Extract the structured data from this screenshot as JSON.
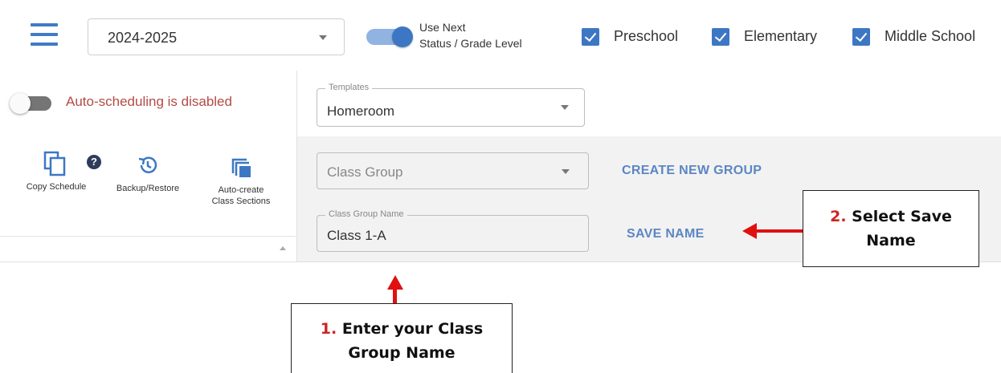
{
  "topbar": {
    "school_year": "2024-2025",
    "use_next_line1": "Use Next",
    "use_next_line2": "Status / Grade Level",
    "use_next_enabled": true,
    "levels": [
      {
        "label": "Preschool",
        "checked": true
      },
      {
        "label": "Elementary",
        "checked": true
      },
      {
        "label": "Middle School",
        "checked": true
      }
    ]
  },
  "sidebar": {
    "auto_scheduling_text": "Auto-scheduling is disabled",
    "auto_scheduling_enabled": false,
    "tools": [
      {
        "label": "Copy Schedule",
        "icon": "copy-icon"
      },
      {
        "label": "Backup/Restore",
        "icon": "history-icon"
      },
      {
        "label_line1": "Auto-create",
        "label_line2": "Class Sections",
        "icon": "library-icon"
      }
    ],
    "help_badge": "?"
  },
  "content": {
    "templates_legend": "Templates",
    "templates_value": "Homeroom",
    "class_group_placeholder": "Class Group",
    "create_new_group": "CREATE NEW GROUP",
    "class_group_name_legend": "Class Group Name",
    "class_group_name_value": "Class 1-A",
    "save_name": "SAVE NAME"
  },
  "callouts": {
    "step1_num": "1.",
    "step1_line1": "Enter your Class",
    "step1_line2": "Group Name",
    "step2_num": "2.",
    "step2_line1": "Select Save",
    "step2_line2": "Name"
  },
  "colors": {
    "accent": "#3d77c4",
    "disabled_text": "#b34b46",
    "link": "#5b86c4",
    "arrow": "#e01010"
  }
}
